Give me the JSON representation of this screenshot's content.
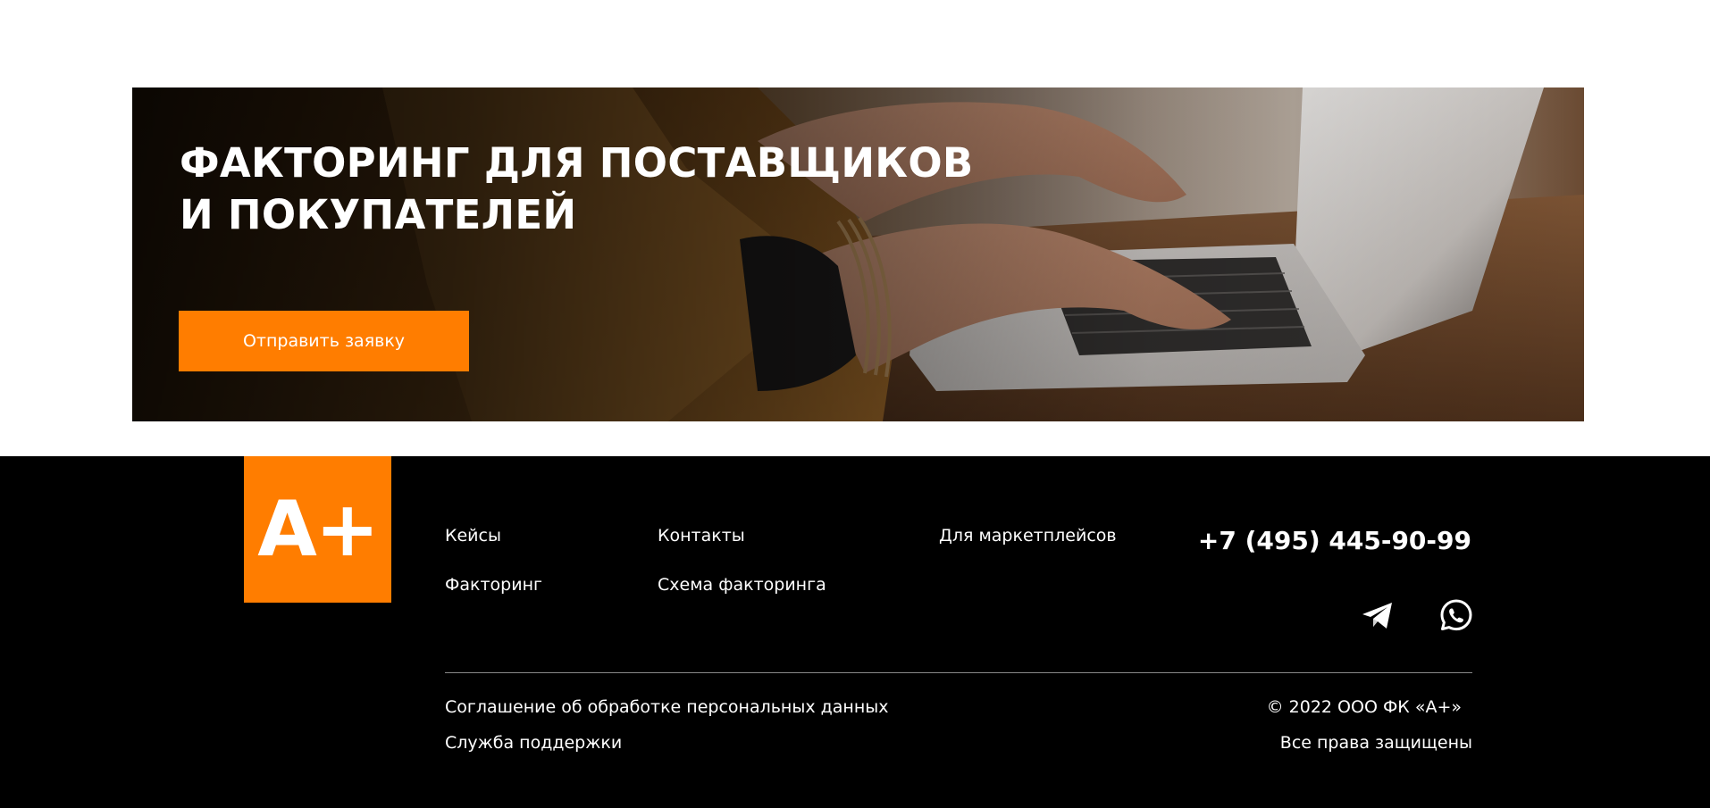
{
  "hero": {
    "title_line1": "ФАКТОРИНГ ДЛЯ ПОСТАВЩИКОВ",
    "title_line2": "И ПОКУПАТЕЛЕЙ",
    "button_label": "Отправить заявку",
    "accent_color": "#ff7d00"
  },
  "footer": {
    "logo_text": "A+",
    "nav": {
      "cases": "Кейсы",
      "contacts": "Контакты",
      "marketplaces": "Для маркетплейсов",
      "factoring": "Факторинг",
      "scheme": "Схема факторинга"
    },
    "phone": "+7 (495) 445-90-99",
    "social": [
      {
        "icon": "telegram-icon"
      },
      {
        "icon": "whatsapp-icon"
      }
    ],
    "agreement_link": "Соглашение об обработке персональных данных",
    "support_link": "Служба поддержки",
    "copyright": "© 2022 ООО ФК «А+»",
    "rights": "Все права защищены",
    "background_color": "#000000"
  }
}
